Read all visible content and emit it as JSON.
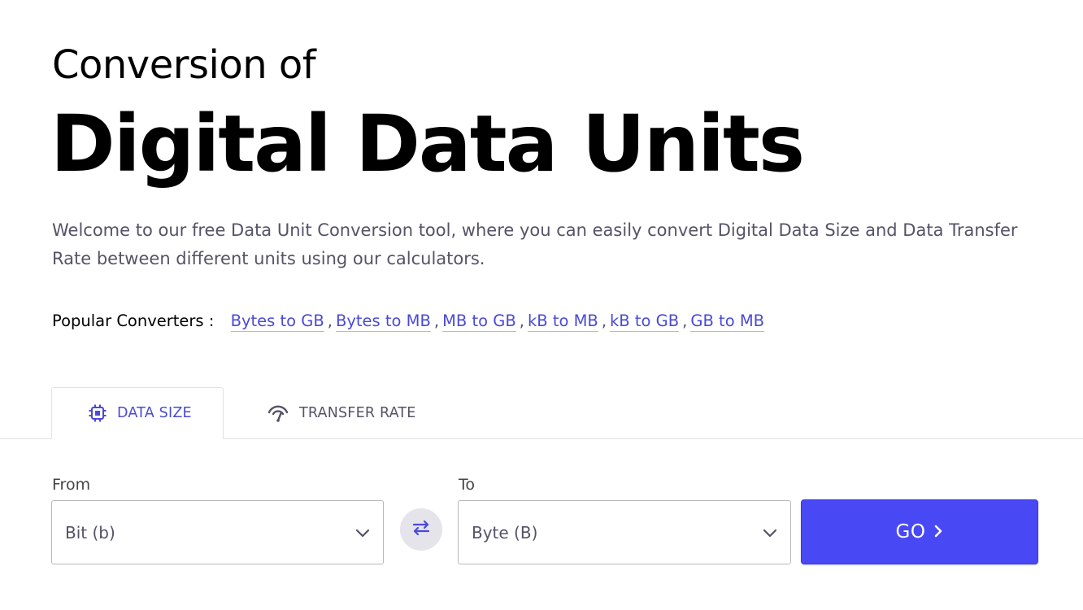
{
  "hero": {
    "top": "Conversion of",
    "main": "Digital Data Units"
  },
  "intro": "Welcome to our free Data Unit Conversion tool, where you can easily convert Digital Data Size and Data Transfer Rate between different units using our calculators.",
  "popular": {
    "label": "Popular Converters :",
    "links": [
      "Bytes to GB",
      "Bytes to MB",
      "MB to GB",
      "kB to MB",
      "kB to GB",
      "GB to MB"
    ],
    "separator": ","
  },
  "tabs": [
    {
      "label": "DATA SIZE",
      "icon": "chip-icon",
      "active": true
    },
    {
      "label": "TRANSFER RATE",
      "icon": "speedometer-icon",
      "active": false
    }
  ],
  "converter": {
    "from_label": "From",
    "from_value": "Bit (b)",
    "to_label": "To",
    "to_value": "Byte (B)",
    "go_label": "GO",
    "go_icon": "chevron-right-icon",
    "swap_icon": "swap-arrows-icon"
  },
  "colors": {
    "accent": "#4848f5",
    "link": "#4a4ad6",
    "muted_text": "#555366"
  }
}
